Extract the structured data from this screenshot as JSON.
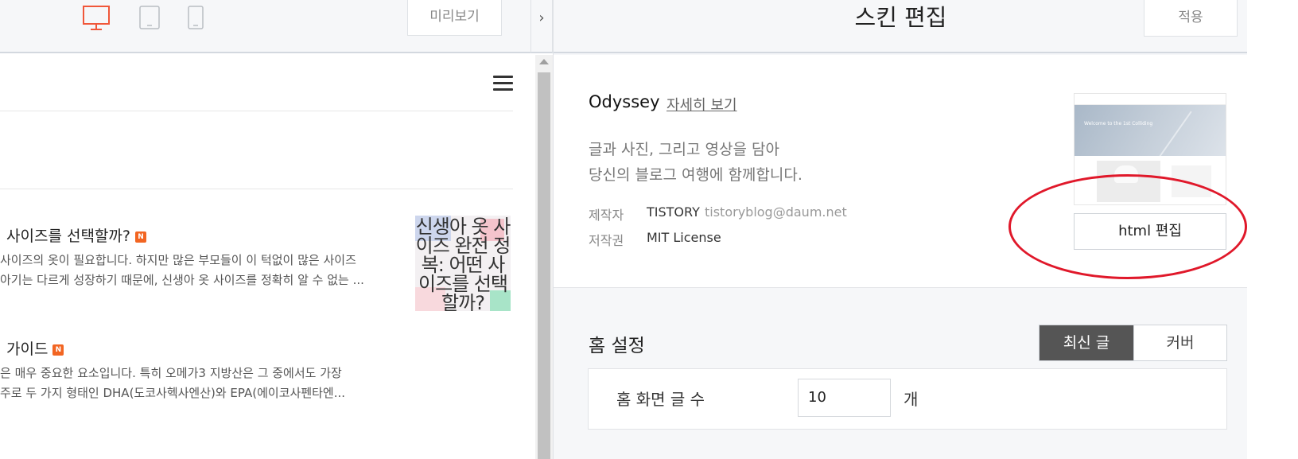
{
  "left_panel": {
    "toolbar": {
      "devices": [
        "desktop-icon",
        "tablet-icon",
        "mobile-icon"
      ],
      "active_device": "desktop",
      "preview_label": "미리보기",
      "collapse_symbol": "›"
    },
    "posts": [
      {
        "title": "사이즈를 선택할까?",
        "badge": "N",
        "excerpt": [
          "사이즈의 옷이 필요합니다. 하지만 많은 부모들이 이 턱없이 많은 사이즈",
          "아기는 다르게 성장하기 때문에, 신생아 옷 사이즈를 정확히 알 수 없는 ..."
        ],
        "thumb_text": "신생아 옷 사이즈 완전 정복: 어떤 사이즈를 선택할까?"
      },
      {
        "title": "가이드",
        "badge": "N",
        "excerpt": [
          "은 매우 중요한 요소입니다. 특히 오메가3 지방산은 그 중에서도 가장",
          "주로 두 가지 형태인 DHA(도코사헥사엔산)와 EPA(에이코사펜타엔..."
        ]
      }
    ]
  },
  "right_panel": {
    "header": {
      "title": "스킨 편집",
      "apply_label": "적용"
    },
    "skin": {
      "name": "Odyssey",
      "detail_link": "자세히 보기",
      "description_line1": "글과 사진, 그리고 영상을 담아",
      "description_line2": "당신의 블로그 여행에 함께합니다.",
      "author_label": "제작자",
      "author": "TISTORY",
      "author_email": "tistoryblog@daum.net",
      "license_label": "저작권",
      "license": "MIT License",
      "thumb_text": "Welcome to the 1st Colliding",
      "html_edit_label": "html 편집"
    },
    "home": {
      "title": "홈 설정",
      "tabs": [
        "최신 글",
        "커버"
      ],
      "active_tab": 0,
      "count_label": "홈 화면 글 수",
      "count_value": "10",
      "count_unit": "개"
    }
  },
  "colors": {
    "accent_red": "#e0182a",
    "active_tab_bg": "#555555",
    "desktop_icon_active": "#f0573a",
    "new_badge": "#f26522"
  }
}
